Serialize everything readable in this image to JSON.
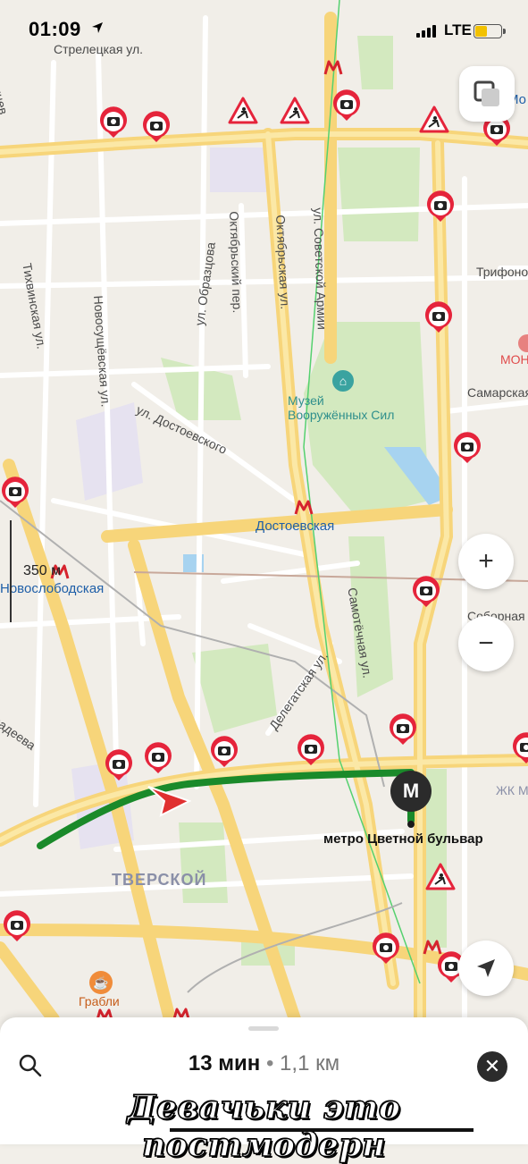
{
  "status_bar": {
    "time": "01:09",
    "network": "LTE"
  },
  "map": {
    "streets": [
      {
        "text": "Стрелецкая ул."
      },
      {
        "text": "ул. Двинцев"
      },
      {
        "text": "Тихвинская ул."
      },
      {
        "text": "Новосущёвская ул."
      },
      {
        "text": "ул. Образцова"
      },
      {
        "text": "Октябрьский пер."
      },
      {
        "text": "Октябрьская ул."
      },
      {
        "text": "ул. Советской Армии"
      },
      {
        "text": "Трифонов"
      },
      {
        "text": "ул. Достоевского"
      },
      {
        "text": "Самарская"
      },
      {
        "text": "Делегатская ул."
      },
      {
        "text": "Самотёчная ул."
      },
      {
        "text": "Соборная"
      },
      {
        "text": "ЖК М"
      },
      {
        "text": "Фадеева"
      },
      {
        "text": "Мо"
      }
    ],
    "metro": [
      "Достоевская",
      "Новослободская"
    ],
    "poi": {
      "museum": "Музей\nВооружённых Сил",
      "monument": "МОН",
      "cafe": "Грабли"
    },
    "destination": "метро Цветной бульвар",
    "destination_marker": "M",
    "district": "ТВЕРСКОЙ",
    "scale": "350 м"
  },
  "controls": {
    "zoom_in": "+",
    "zoom_out": "−"
  },
  "bottom_panel": {
    "duration": "13 мин",
    "separator": "•",
    "distance": "1,1 км"
  },
  "caption": "Девачьки это постмодерн",
  "colors": {
    "route": "#1a8a2a",
    "camera": "#e5243b",
    "road_major": "#f7d879",
    "park": "#cfe6b8",
    "metro": "#d6232d"
  }
}
